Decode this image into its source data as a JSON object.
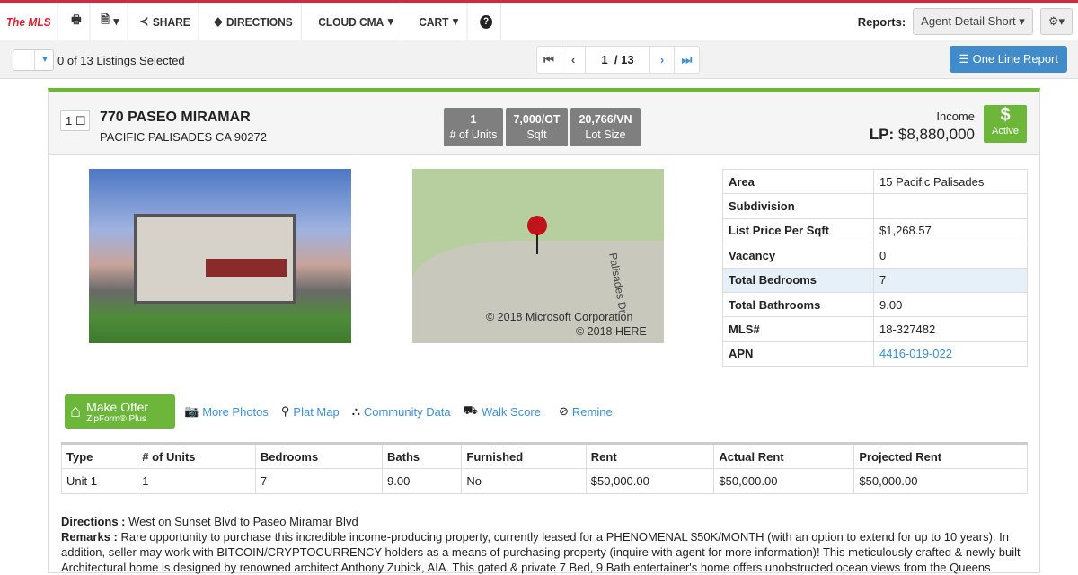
{
  "toolbar": {
    "logo": "The MLS",
    "share": "SHARE",
    "directions": "DIRECTIONS",
    "cloud_cma": "CLOUD CMA",
    "cart": "CART",
    "reports_label": "Reports:",
    "report_select": "Agent Detail Short"
  },
  "selection": {
    "text": "0 of 13 Listings Selected"
  },
  "pager": {
    "current": "1",
    "total": "/ 13"
  },
  "one_line_report": "One Line Report",
  "listing": {
    "index": "1",
    "address": "770 PASEO MIRAMAR",
    "city": "PACIFIC PALISADES CA 90272",
    "stats": [
      {
        "value": "1",
        "label": "# of Units"
      },
      {
        "value": "7,000/OT",
        "label": "Sqft"
      },
      {
        "value": "20,766/VN",
        "label": "Lot Size"
      }
    ],
    "type": "Income",
    "lp_label": "LP:",
    "lp_value": "$8,880,000",
    "status": "Active",
    "status_icon": "$",
    "map_credit1": "© 2018 Microsoft Corporation",
    "map_credit2": "© 2018 HERE",
    "map_street": "Palisades Dr",
    "details": [
      {
        "k": "Area",
        "v": "15 Pacific Palisades"
      },
      {
        "k": "Subdivision",
        "v": ""
      },
      {
        "k": "List Price Per Sqft",
        "v": "$1,268.57"
      },
      {
        "k": "Vacancy",
        "v": "0"
      },
      {
        "k": "Total Bedrooms",
        "v": "7"
      },
      {
        "k": "Total Bathrooms",
        "v": "9.00"
      },
      {
        "k": "MLS#",
        "v": "18-327482"
      },
      {
        "k": "APN",
        "v": "4416-019-022"
      }
    ]
  },
  "actions": {
    "make_offer": "Make Offer",
    "zipform": "ZipForm® Plus",
    "more_photos": "More Photos",
    "plat_map": "Plat Map",
    "community": "Community Data",
    "walk_score": "Walk Score",
    "remine": "Remine"
  },
  "units": {
    "headers": [
      "Type",
      "# of Units",
      "Bedrooms",
      "Baths",
      "Furnished",
      "Rent",
      "Actual Rent",
      "Projected Rent"
    ],
    "rows": [
      [
        "Unit 1",
        "1",
        "7",
        "9.00",
        "No",
        "$50,000.00",
        "$50,000.00",
        "$50,000.00"
      ]
    ]
  },
  "remarks": {
    "directions_label": "Directions :",
    "directions": "West on Sunset Blvd to Paseo Miramar Blvd",
    "remarks_label": "Remarks :",
    "remarks": "Rare opportunity to purchase this incredible income-producing property, currently leased for a PHENOMENAL $50K/MONTH (with an option to extend for up to 10 years). In addition, seller may work with BITCOIN/CRYPTOCURRENCY holders as a means of purchasing property (inquire with agent for more information)! This meticulously crafted & newly built Architectural home is designed by renowned architect Anthony Zubick, AIA. This gated & private 7 Bed, 9 Bath entertainer's home offers unobstructed ocean views from the Queens"
  }
}
